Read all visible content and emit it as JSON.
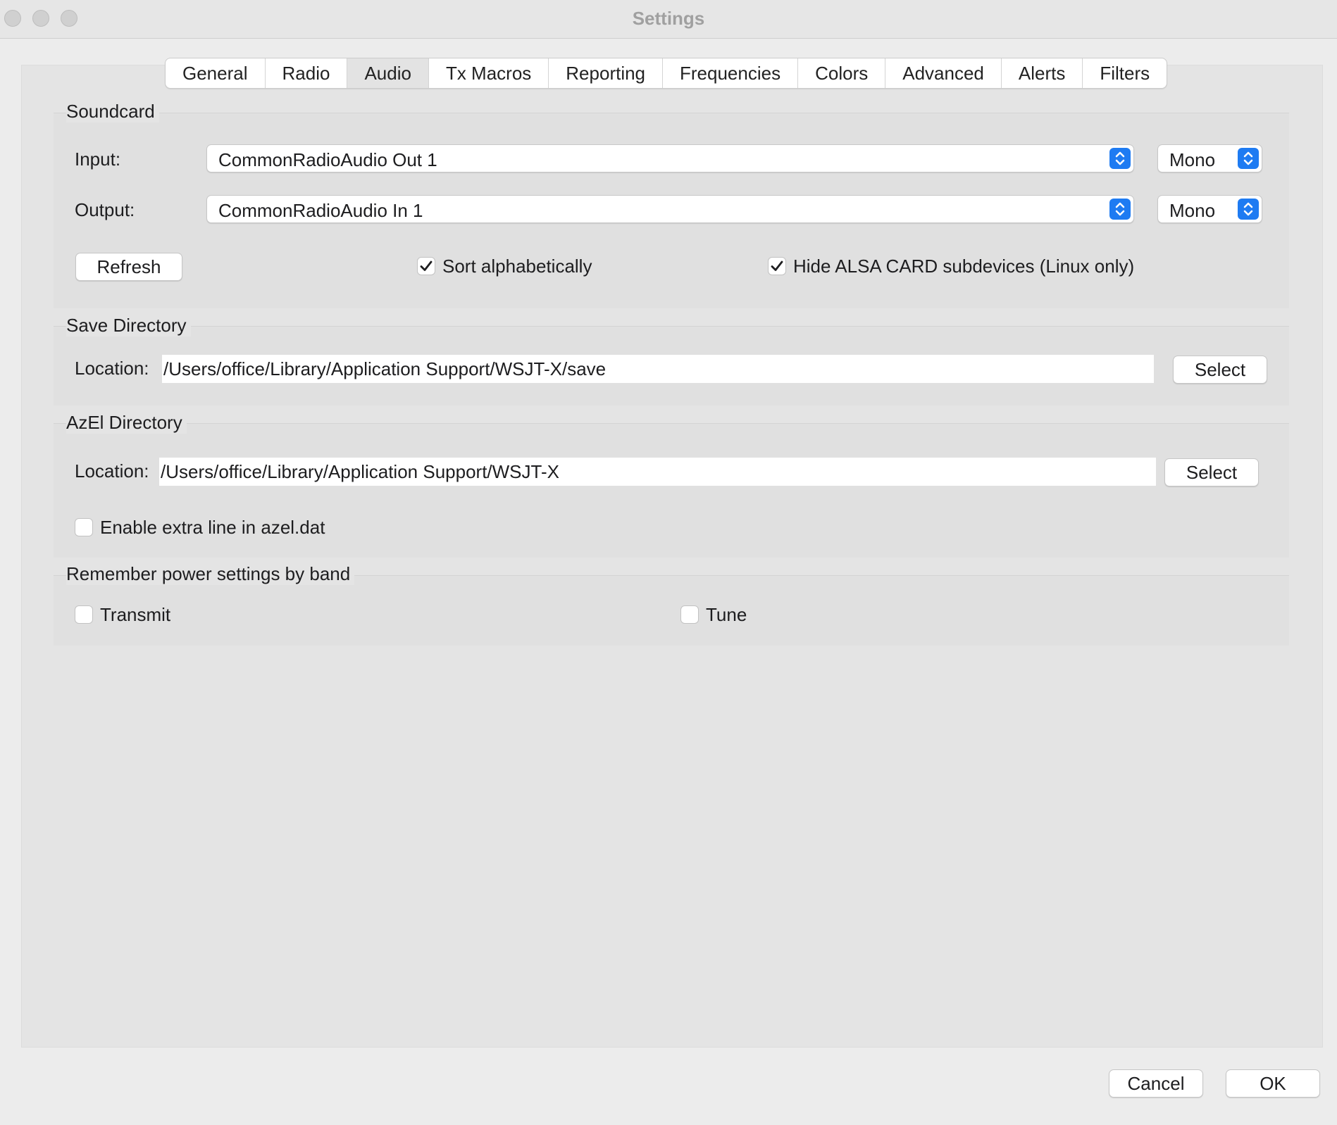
{
  "window": {
    "title": "Settings"
  },
  "tabs": [
    {
      "label": "General",
      "active": false
    },
    {
      "label": "Radio",
      "active": false
    },
    {
      "label": "Audio",
      "active": true
    },
    {
      "label": "Tx Macros",
      "active": false
    },
    {
      "label": "Reporting",
      "active": false
    },
    {
      "label": "Frequencies",
      "active": false
    },
    {
      "label": "Colors",
      "active": false
    },
    {
      "label": "Advanced",
      "active": false
    },
    {
      "label": "Alerts",
      "active": false
    },
    {
      "label": "Filters",
      "active": false
    }
  ],
  "soundcard": {
    "title": "Soundcard",
    "input_label": "Input:",
    "input_device": "CommonRadioAudio Out 1",
    "input_channel": "Mono",
    "output_label": "Output:",
    "output_device": "CommonRadioAudio In 1",
    "output_channel": "Mono",
    "refresh_label": "Refresh",
    "sort_label": "Sort alphabetically",
    "sort_checked": true,
    "hide_alsa_label": "Hide ALSA CARD subdevices (Linux only)",
    "hide_alsa_checked": true
  },
  "save_directory": {
    "title": "Save Directory",
    "location_label": "Location:",
    "location_value": "/Users/office/Library/Application Support/WSJT-X/save",
    "select_label": "Select"
  },
  "azel_directory": {
    "title": "AzEl Directory",
    "location_label": "Location:",
    "location_value": "/Users/office/Library/Application Support/WSJT-X",
    "select_label": "Select",
    "extra_line_label": "Enable extra line in azel.dat",
    "extra_line_checked": false
  },
  "power": {
    "title": "Remember power settings by band",
    "transmit_label": "Transmit",
    "transmit_checked": false,
    "tune_label": "Tune",
    "tune_checked": false
  },
  "footer": {
    "cancel_label": "Cancel",
    "ok_label": "OK"
  },
  "colors": {
    "accent": "#1e7bf2",
    "window_bg": "#ececec",
    "title_text": "#a0a0a0"
  }
}
